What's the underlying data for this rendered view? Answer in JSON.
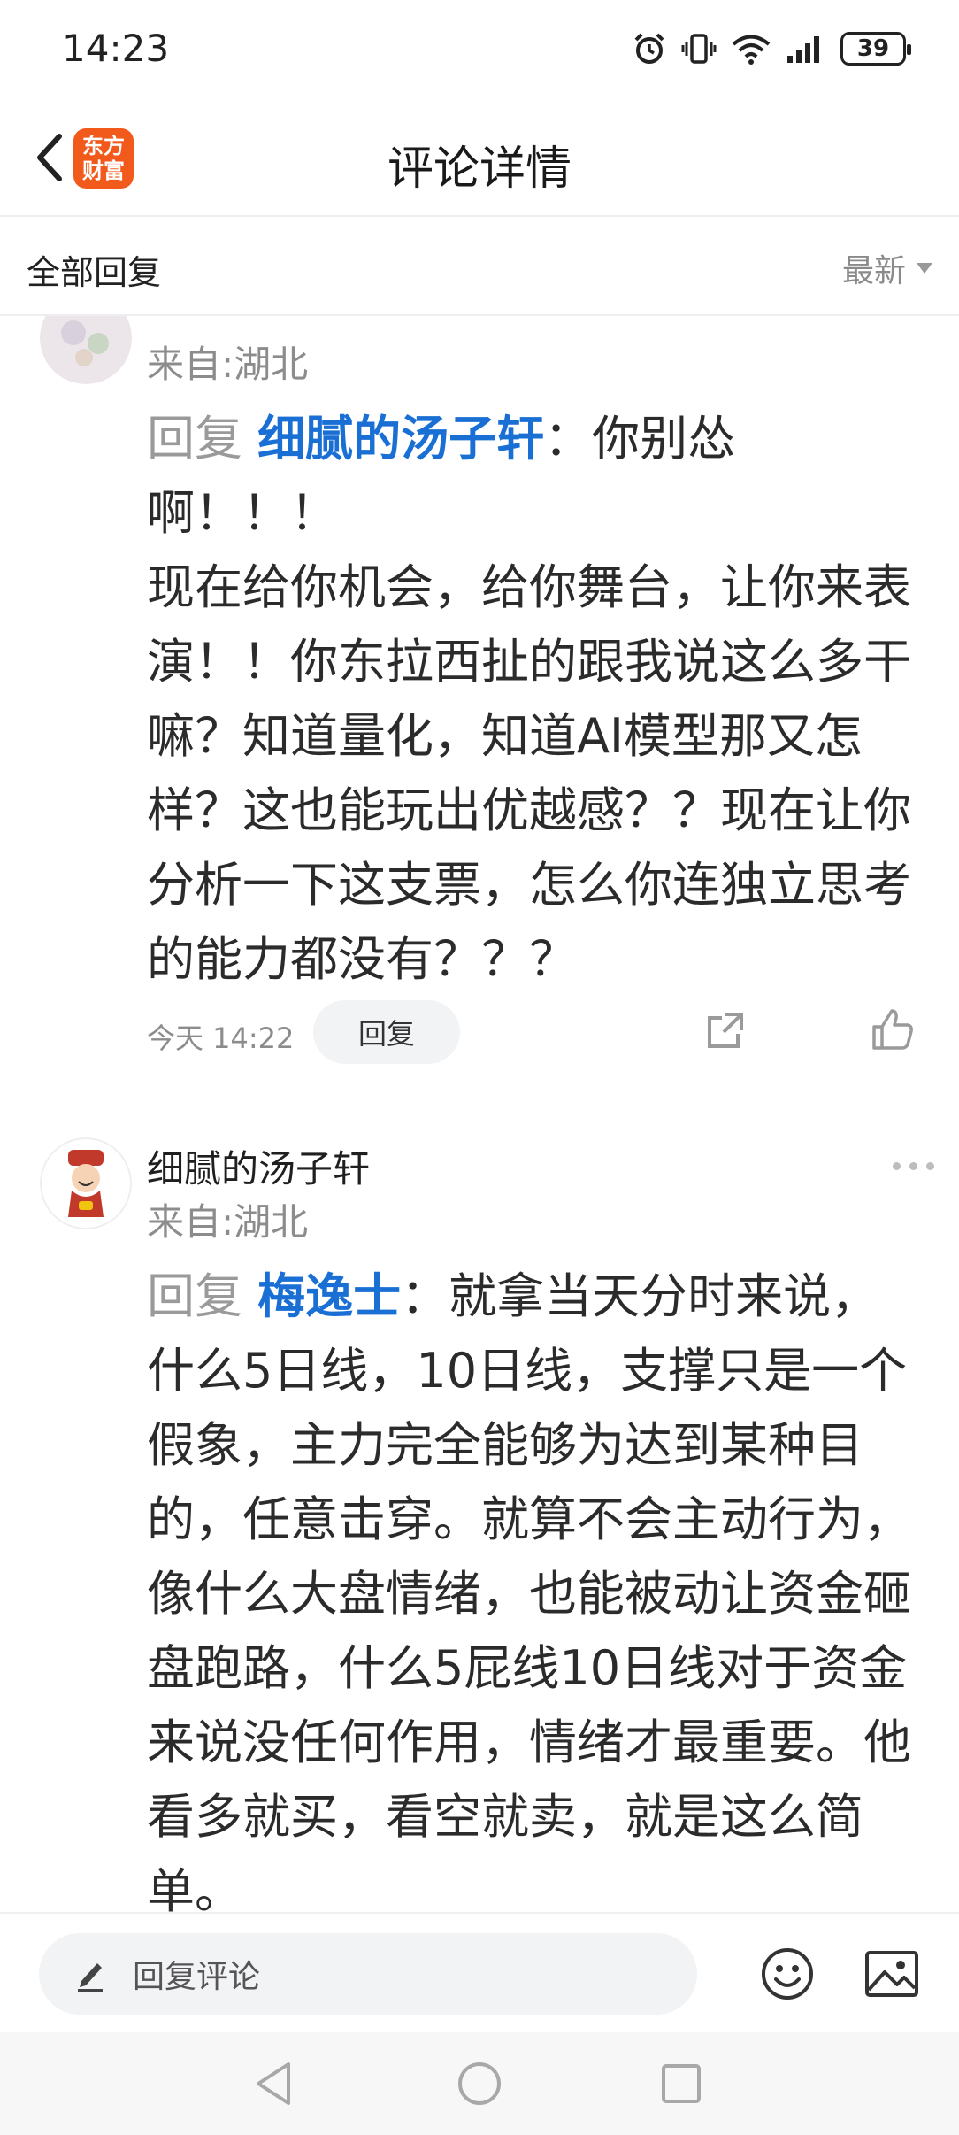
{
  "status": {
    "time": "14:23",
    "battery": "39"
  },
  "nav": {
    "title": "评论详情",
    "logo_line1": "东方",
    "logo_line2": "财富",
    "logo_color": "#f25a1c"
  },
  "section": {
    "title": "全部回复",
    "sort_label": "最新"
  },
  "comments": [
    {
      "origin": "来自:湖北",
      "reply_prefix": "回复",
      "reply_to": "细腻的汤子轩",
      "reply_colon": "：",
      "text": "你别怂啊！！！\n现在给你机会，给你舞台，让你来表演！！你东拉西扯的跟我说这么多干嘛？知道量化，知道AI模型那又怎样？这也能玩出优越感？？现在让你分析一下这支票，怎么你连独立思考的能力都没有？？？",
      "time": "今天 14:22",
      "reply_label": "回复"
    },
    {
      "author": "细腻的汤子轩",
      "origin": "来自:湖北",
      "reply_prefix": "回复",
      "reply_to": "梅逸士",
      "reply_colon": "：",
      "text": "就拿当天分时来说，什么5日线，10日线，支撑只是一个假象，主力完全能够为达到某种目的，任意击穿。就算不会主动行为，像什么大盘情绪，也能被动让资金砸盘跑路，什么5屁线10日线对于资金来说没任何作用，情绪才最重要。他看多就买，看空就卖，就是这么简单。"
    }
  ],
  "input": {
    "placeholder": "回复评论"
  },
  "colors": {
    "link": "#1a6fd4",
    "muted": "#8c8c8c"
  },
  "icons": [
    "back-icon",
    "alarm-icon",
    "vibrate-icon",
    "wifi-icon",
    "signal-icon",
    "battery-icon",
    "share-icon",
    "like-icon",
    "more-icon",
    "pencil-icon",
    "emoji-icon",
    "image-icon",
    "nav-back-icon",
    "nav-home-icon",
    "nav-recent-icon"
  ]
}
